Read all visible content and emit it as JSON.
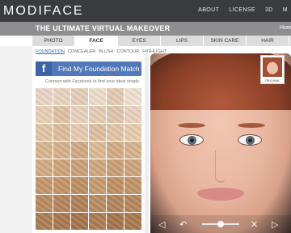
{
  "header": {
    "logo": "MODIFACE",
    "nav": [
      "ABOUT",
      "LICENSE",
      "3D",
      "M"
    ]
  },
  "titlebar": {
    "title": "THE ULTIMATE VIRTUAL MAKEOVER",
    "right_text": "How"
  },
  "tabs": [
    {
      "label": "PHOTO",
      "active": false
    },
    {
      "label": "FACE",
      "active": true
    },
    {
      "label": "EYES",
      "active": false
    },
    {
      "label": "LIPS",
      "active": false
    },
    {
      "label": "SKIN CARE",
      "active": false
    },
    {
      "label": "HAIR",
      "active": false
    }
  ],
  "subtabs": [
    {
      "label": "FOUNDATION",
      "active": true
    },
    {
      "label": "CONCEALER",
      "active": false
    },
    {
      "label": "BLUSH",
      "active": false
    },
    {
      "label": "CONTOUR",
      "active": false
    },
    {
      "label": "HIGHLIGHT",
      "active": false
    }
  ],
  "facebook": {
    "icon": "f",
    "button_label": "Find My Foundation Match",
    "note": "Connect with Facebook to find your ideal shade"
  },
  "swatches": [
    "#e9d4c4",
    "#ead3bf",
    "#e6cdb7",
    "#ecdcca",
    "#e4c9b2",
    "#f0dfd0",
    "#e8cfb6",
    "#e0c2a4",
    "#e9d1bb",
    "#e5ccb5",
    "#dfc5ab",
    "#e8d2bd",
    "#e2c4a6",
    "#dcbd9c",
    "#e6cbb0",
    "#ddbfa0",
    "#e1c5a8",
    "#e7cbaf",
    "#d9b48e",
    "#d6b08a",
    "#d2a982",
    "#dcb993",
    "#d3ab84",
    "#d7b28c",
    "#d4a983",
    "#cfa27a",
    "#caa078",
    "#d1a77f",
    "#c99e75",
    "#cda47c",
    "#c5966c",
    "#c39467",
    "#be8f62",
    "#c79a6e",
    "#bf8f63",
    "#c29366",
    "#b98a5e",
    "#b5845a",
    "#b18057",
    "#b98b60",
    "#b2845a",
    "#b58759",
    "#ac7c53",
    "#a9774f",
    "#a5734b",
    "#ab7b52",
    "#a3744c",
    "#a8784f"
  ],
  "preview": {
    "thumb_caption": "ORIGINAL"
  },
  "controls": {
    "left_icon": "◁",
    "undo_icon": "↶",
    "close_icon": "✕",
    "right_icon": "▷",
    "zoom_level": 0.5
  },
  "colors": {
    "topbar": "#3a3b3e",
    "titlebar": "#8e8e90",
    "facebook": "#5178b8",
    "accent_link": "#2d6ea8"
  }
}
